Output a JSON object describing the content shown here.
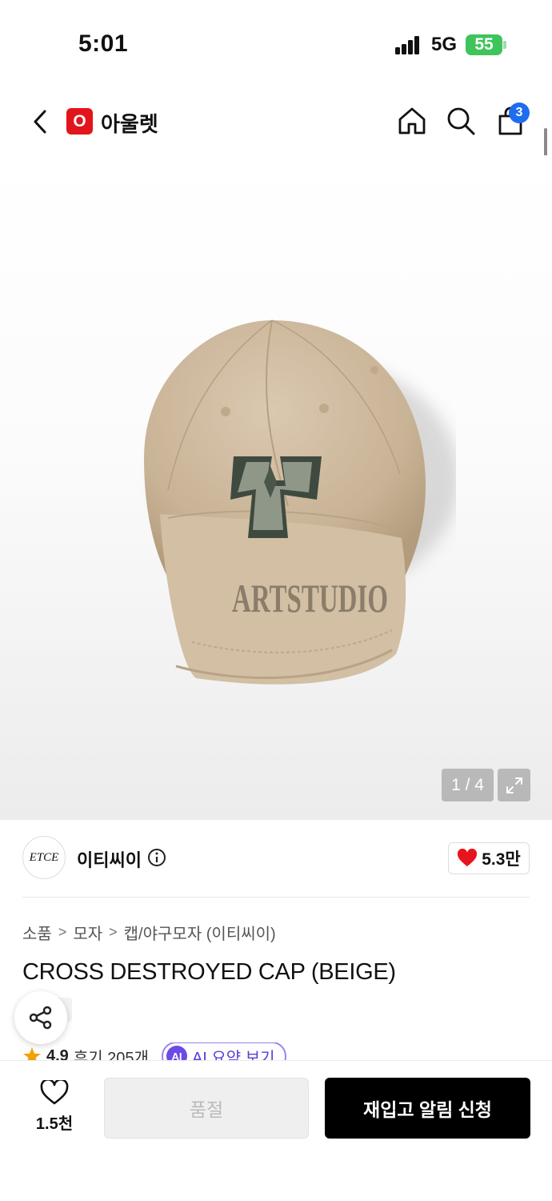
{
  "status_bar": {
    "time": "5:01",
    "network": "5G",
    "battery": "55"
  },
  "header": {
    "app_name": "아울렛",
    "logo_letter": "O",
    "cart_count": "3"
  },
  "gallery": {
    "counter": "1 / 4",
    "cap_text": "ARTSTUDIO"
  },
  "brand": {
    "logo_text": "ETCE",
    "name": "이티씨이",
    "likes": "5.3만"
  },
  "breadcrumb": [
    "소품",
    "모자",
    "캡/야구모자 (이티씨이)"
  ],
  "product": {
    "title": "CROSS DESTROYED CAP (BEIGE)"
  },
  "rating": {
    "score": "4.9",
    "reviews": "후기 205개",
    "ai_badge": "AI",
    "ai_label": "AI 요약 보기"
  },
  "bottom_bar": {
    "wish_count": "1.5천",
    "soldout_label": "품절",
    "restock_label": "재입고 알림 신청"
  },
  "colors": {
    "accent_red": "#e3141b",
    "badge_blue": "#1e6cf0",
    "ai_purple": "#6b4ae8",
    "battery_green": "#3ec45a"
  },
  "icons": [
    "back-arrow-icon",
    "home-icon",
    "search-icon",
    "shopping-bag-icon",
    "expand-icon",
    "info-icon",
    "heart-filled-icon",
    "share-icon",
    "star-icon",
    "heart-outline-icon"
  ]
}
